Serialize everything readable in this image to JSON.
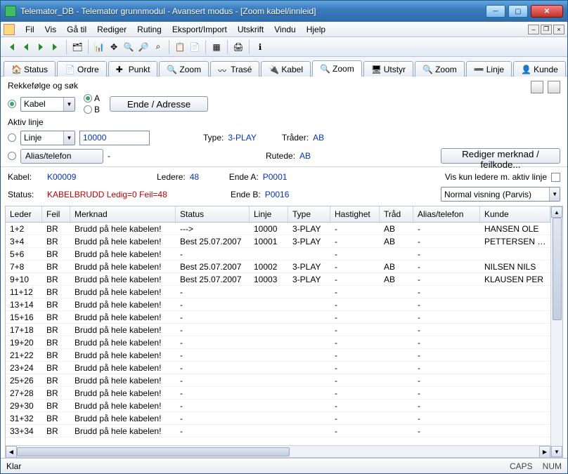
{
  "window": {
    "title": "Telemator_DB - Telemator grunnmodul - Avansert modus - [Zoom kabel/innleid]"
  },
  "menu": [
    "Fil",
    "Vis",
    "Gå til",
    "Rediger",
    "Ruting",
    "Eksport/Import",
    "Utskrift",
    "Vindu",
    "Hjelp"
  ],
  "tabs": [
    {
      "label": "Status"
    },
    {
      "label": "Ordre"
    },
    {
      "label": "Punkt"
    },
    {
      "label": "Zoom"
    },
    {
      "label": "Trasé"
    },
    {
      "label": "Kabel"
    },
    {
      "label": "Zoom",
      "active": true
    },
    {
      "label": "Utstyr"
    },
    {
      "label": "Zoom"
    },
    {
      "label": "Linje"
    },
    {
      "label": "Kunde"
    }
  ],
  "panel": {
    "group1": "Rekkefølge og søk",
    "kabel_combo": "Kabel",
    "radio_a": "A",
    "radio_b": "B",
    "ende_btn": "Ende / Adresse",
    "group2": "Aktiv linje",
    "linje_combo": "Linje",
    "linje_value": "10000",
    "type_lbl": "Type:",
    "type_val": "3-PLAY",
    "trader_lbl": "Tråder:",
    "trader_val": "AB",
    "alias_btn": "Alias/telefon",
    "alias_val": "-",
    "rutede_lbl": "Rutede:",
    "rutede_val": "AB",
    "rediger_btn": "Rediger merknad / feilkode..."
  },
  "info": {
    "kabel_lbl": "Kabel:",
    "kabel_val": "K00009",
    "ledere_lbl": "Ledere:",
    "ledere_val": "48",
    "endeA_lbl": "Ende A:",
    "endeA_val": "P0001",
    "status_lbl": "Status:",
    "status_val": "KABELBRUDD Ledig=0 Feil=48",
    "endeB_lbl": "Ende B:",
    "endeB_val": "P0016",
    "viskun": "Vis kun ledere m. aktiv linje",
    "viewmode": "Normal visning (Parvis)"
  },
  "columns": [
    "Leder",
    "Feil",
    "Merknad",
    "Status",
    "Linje",
    "Type",
    "Hastighet",
    "Tråd",
    "Alias/telefon",
    "Kunde"
  ],
  "rows": [
    {
      "leder": "1+2",
      "feil": "BR",
      "merk": "Brudd på hele kabelen!",
      "status": "--->",
      "linje": "10000",
      "type": "3-PLAY",
      "hast": "-",
      "trad": "AB",
      "alias": "-",
      "kunde": "HANSEN OLE"
    },
    {
      "leder": "3+4",
      "feil": "BR",
      "merk": "Brudd på hele kabelen!",
      "status": "Best 25.07.2007",
      "linje": "10001",
      "type": "3-PLAY",
      "hast": "-",
      "trad": "AB",
      "alias": "-",
      "kunde": "PETTERSEN KNUT"
    },
    {
      "leder": "5+6",
      "feil": "BR",
      "merk": "Brudd på hele kabelen!",
      "status": "-",
      "linje": "",
      "type": "",
      "hast": "-",
      "trad": "",
      "alias": "-",
      "kunde": ""
    },
    {
      "leder": "7+8",
      "feil": "BR",
      "merk": "Brudd på hele kabelen!",
      "status": "Best 25.07.2007",
      "linje": "10002",
      "type": "3-PLAY",
      "hast": "-",
      "trad": "AB",
      "alias": "-",
      "kunde": "NILSEN NILS"
    },
    {
      "leder": "9+10",
      "feil": "BR",
      "merk": "Brudd på hele kabelen!",
      "status": "Best 25.07.2007",
      "linje": "10003",
      "type": "3-PLAY",
      "hast": "-",
      "trad": "AB",
      "alias": "-",
      "kunde": "KLAUSEN PER"
    },
    {
      "leder": "11+12",
      "feil": "BR",
      "merk": "Brudd på hele kabelen!",
      "status": "-",
      "linje": "",
      "type": "",
      "hast": "-",
      "trad": "",
      "alias": "-",
      "kunde": ""
    },
    {
      "leder": "13+14",
      "feil": "BR",
      "merk": "Brudd på hele kabelen!",
      "status": "-",
      "linje": "",
      "type": "",
      "hast": "-",
      "trad": "",
      "alias": "-",
      "kunde": ""
    },
    {
      "leder": "15+16",
      "feil": "BR",
      "merk": "Brudd på hele kabelen!",
      "status": "-",
      "linje": "",
      "type": "",
      "hast": "-",
      "trad": "",
      "alias": "-",
      "kunde": ""
    },
    {
      "leder": "17+18",
      "feil": "BR",
      "merk": "Brudd på hele kabelen!",
      "status": "-",
      "linje": "",
      "type": "",
      "hast": "-",
      "trad": "",
      "alias": "-",
      "kunde": ""
    },
    {
      "leder": "19+20",
      "feil": "BR",
      "merk": "Brudd på hele kabelen!",
      "status": "-",
      "linje": "",
      "type": "",
      "hast": "-",
      "trad": "",
      "alias": "-",
      "kunde": ""
    },
    {
      "leder": "21+22",
      "feil": "BR",
      "merk": "Brudd på hele kabelen!",
      "status": "-",
      "linje": "",
      "type": "",
      "hast": "-",
      "trad": "",
      "alias": "-",
      "kunde": ""
    },
    {
      "leder": "23+24",
      "feil": "BR",
      "merk": "Brudd på hele kabelen!",
      "status": "-",
      "linje": "",
      "type": "",
      "hast": "-",
      "trad": "",
      "alias": "-",
      "kunde": ""
    },
    {
      "leder": "25+26",
      "feil": "BR",
      "merk": "Brudd på hele kabelen!",
      "status": "-",
      "linje": "",
      "type": "",
      "hast": "-",
      "trad": "",
      "alias": "-",
      "kunde": ""
    },
    {
      "leder": "27+28",
      "feil": "BR",
      "merk": "Brudd på hele kabelen!",
      "status": "-",
      "linje": "",
      "type": "",
      "hast": "-",
      "trad": "",
      "alias": "-",
      "kunde": ""
    },
    {
      "leder": "29+30",
      "feil": "BR",
      "merk": "Brudd på hele kabelen!",
      "status": "-",
      "linje": "",
      "type": "",
      "hast": "-",
      "trad": "",
      "alias": "-",
      "kunde": ""
    },
    {
      "leder": "31+32",
      "feil": "BR",
      "merk": "Brudd på hele kabelen!",
      "status": "-",
      "linje": "",
      "type": "",
      "hast": "-",
      "trad": "",
      "alias": "-",
      "kunde": ""
    },
    {
      "leder": "33+34",
      "feil": "BR",
      "merk": "Brudd på hele kabelen!",
      "status": "-",
      "linje": "",
      "type": "",
      "hast": "-",
      "trad": "",
      "alias": "-",
      "kunde": ""
    }
  ],
  "statusbar": {
    "left": "Klar",
    "caps": "CAPS",
    "num": "NUM"
  }
}
